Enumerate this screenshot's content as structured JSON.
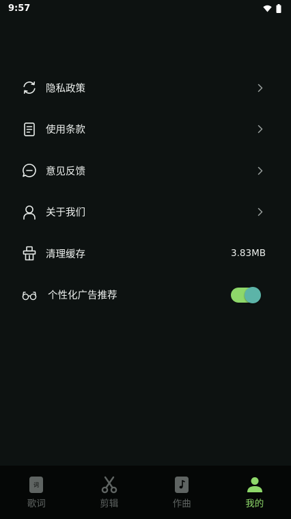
{
  "status_bar": {
    "time": "9:57",
    "icons": [
      "wifi-icon",
      "battery-icon"
    ]
  },
  "settings": [
    {
      "label": "隐私政策",
      "icon": "sync-icon",
      "chevron": true
    },
    {
      "label": "使用条款",
      "icon": "document-icon",
      "chevron": true
    },
    {
      "label": "意见反馈",
      "icon": "chat-bubble-icon",
      "chevron": true
    },
    {
      "label": "关于我们",
      "icon": "user-icon",
      "chevron": true
    },
    {
      "label": "清理缓存",
      "icon": "broom-icon",
      "value": "3.83MB"
    },
    {
      "label": "个性化广告推荐",
      "icon": "glasses-icon",
      "toggle_on": true
    }
  ],
  "tabs": [
    {
      "label": "歌词",
      "icon": "lyrics-icon",
      "active": false
    },
    {
      "label": "剪辑",
      "icon": "scissors-icon",
      "active": false
    },
    {
      "label": "作曲",
      "icon": "compose-icon",
      "active": false
    },
    {
      "label": "我的",
      "icon": "profile-icon",
      "active": true
    }
  ],
  "colors": {
    "background": "#0d1211",
    "tab_bar": "#050706",
    "accent": "#8ed86a",
    "toggle_knob": "#5cb4a8",
    "inactive_tab": "#5f6462"
  }
}
